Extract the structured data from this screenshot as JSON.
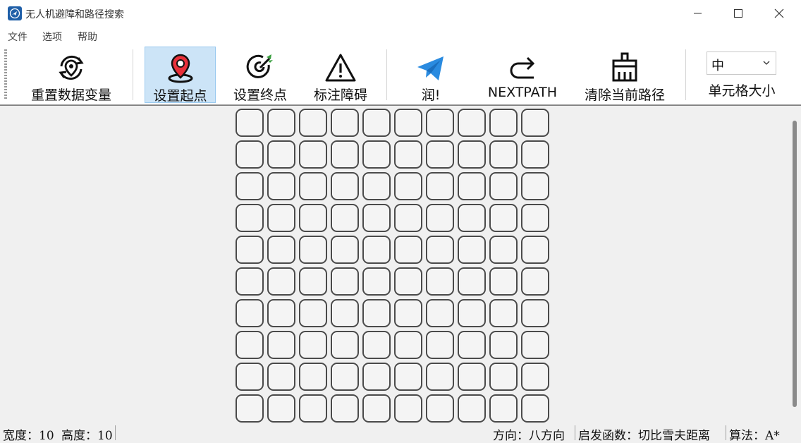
{
  "window": {
    "title": "无人机避障和路径搜索"
  },
  "menu": {
    "file": "文件",
    "options": "选项",
    "help": "帮助"
  },
  "toolbar": {
    "reset": "重置数据变量",
    "set_start": "设置起点",
    "set_end": "设置终点",
    "mark_obstacle": "标注障碍",
    "run": "润!",
    "next_path": "NEXTPATH",
    "clear_path": "清除当前路径",
    "cell_size_value": "中",
    "cell_size_label": "单元格大小"
  },
  "grid": {
    "rows": 10,
    "cols": 10
  },
  "status": {
    "width": "宽度：10",
    "height": "高度：10",
    "direction": "方向：八方向",
    "heuristic": "启发函数：切比雪夫距离",
    "algorithm": "算法：A*"
  },
  "colors": {
    "active_button": "#cce4f7",
    "start_pin": "#e8303a",
    "send_icon": "#2a8be0",
    "target_leaf": "#3aa040"
  }
}
